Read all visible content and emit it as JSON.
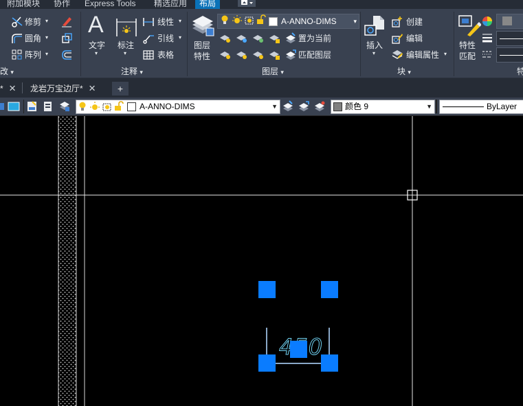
{
  "menu_tabs": [
    {
      "label": "附加模块",
      "active": false
    },
    {
      "label": "协作",
      "active": false
    },
    {
      "label": "Express Tools",
      "active": false
    },
    {
      "label": "精选应用",
      "active": false
    },
    {
      "label": "布局",
      "active": true
    }
  ],
  "ribbon": {
    "modify": {
      "trim_label": "修剪",
      "fillet_label": "圆角",
      "array_label": "阵列",
      "panel_title": "改"
    },
    "annotation": {
      "text_label": "文字",
      "dimension_label": "标注",
      "linear_label": "线性",
      "leader_label": "引线",
      "table_label": "表格",
      "panel_title": "注释"
    },
    "layers": {
      "layer_properties_label_1": "图层",
      "layer_properties_label_2": "特性",
      "current_layer": "A-ANNO-DIMS",
      "set_current_label": "置为当前",
      "match_layer_label": "匹配图层",
      "panel_title": "图层"
    },
    "block": {
      "insert_label": "插入",
      "create_label": "创建",
      "edit_label": "编辑",
      "edit_attributes_label": "编辑属性",
      "panel_title": "块"
    },
    "properties": {
      "match_label_1": "特性",
      "match_label_2": "匹配",
      "panel_title": "特"
    }
  },
  "doc_tabs": [
    {
      "label": "*",
      "closable": true
    },
    {
      "label": "龙岩万宝边厅*",
      "closable": true
    }
  ],
  "new_tab_symbol": "+",
  "close_symbol": "✕",
  "propbar": {
    "layer": "A-ANNO-DIMS",
    "color": "颜色 9",
    "linetype": "ByLayer"
  },
  "drawing": {
    "dimension_text": "450"
  },
  "colors": {
    "grip": "#0a7cff",
    "ribbon_bg": "#394150",
    "active_tab": "#0a72b8",
    "canvas_bg": "#000000"
  }
}
